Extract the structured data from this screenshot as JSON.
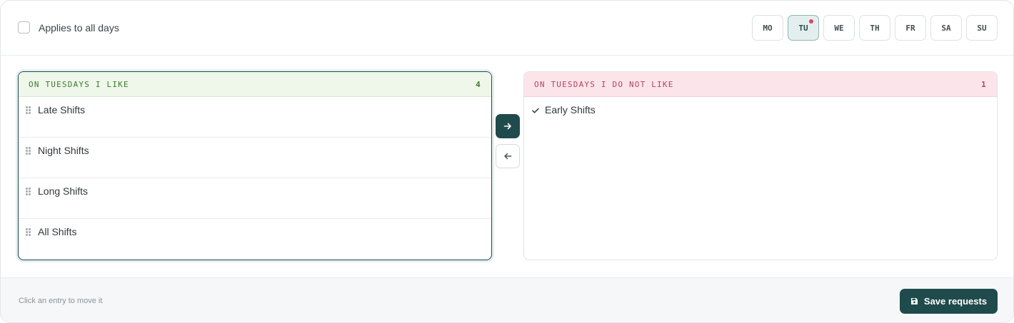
{
  "applies_all": {
    "label": "Applies to all days",
    "checked": false
  },
  "days": [
    {
      "label": "MO",
      "active": false,
      "has_dot": false
    },
    {
      "label": "TU",
      "active": true,
      "has_dot": true
    },
    {
      "label": "WE",
      "active": false,
      "has_dot": false
    },
    {
      "label": "TH",
      "active": false,
      "has_dot": false
    },
    {
      "label": "FR",
      "active": false,
      "has_dot": false
    },
    {
      "label": "SA",
      "active": false,
      "has_dot": false
    },
    {
      "label": "SU",
      "active": false,
      "has_dot": false
    }
  ],
  "like_panel": {
    "title": "ON TUESDAYS I LIKE",
    "count": "4",
    "items": [
      {
        "label": "Late Shifts",
        "icon": "drag-handle-icon"
      },
      {
        "label": "Night Shifts",
        "icon": "drag-handle-icon"
      },
      {
        "label": "Long Shifts",
        "icon": "drag-handle-icon"
      },
      {
        "label": "All Shifts",
        "icon": "drag-handle-icon"
      }
    ]
  },
  "dislike_panel": {
    "title": "ON TUESDAYS I DO NOT LIKE",
    "count": "1",
    "items": [
      {
        "label": "Early Shifts",
        "icon": "check-icon"
      }
    ]
  },
  "move_buttons": {
    "right_icon": "arrow-right-icon",
    "left_icon": "arrow-left-icon"
  },
  "footer": {
    "hint": "Click an entry to move it",
    "save_label": "Save requests",
    "save_icon": "floppy-disk-icon"
  },
  "colors": {
    "accent": "#1f4b4c",
    "like_bg": "#eef7ea",
    "like_text": "#3e7a2c",
    "dislike_bg": "#fbe5ea",
    "dislike_text": "#b24462",
    "dot": "#d6486b"
  }
}
